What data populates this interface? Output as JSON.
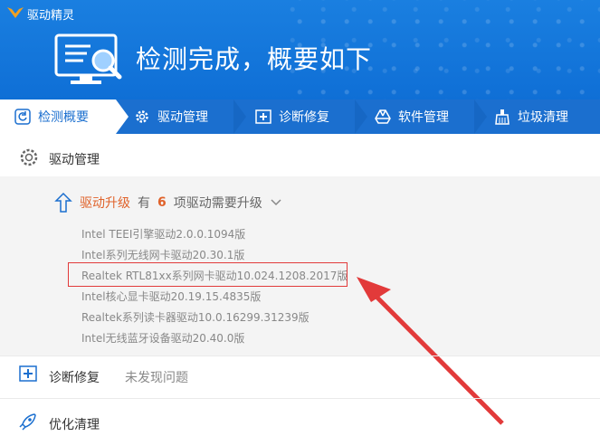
{
  "app": {
    "title": "驱动精灵"
  },
  "header": {
    "headline": "检测完成，概要如下"
  },
  "tabs": [
    {
      "label": "检测概要",
      "icon": "refresh-icon",
      "active": true
    },
    {
      "label": "驱动管理",
      "icon": "gear-icon",
      "active": false
    },
    {
      "label": "诊断修复",
      "icon": "medkit-icon",
      "active": false
    },
    {
      "label": "软件管理",
      "icon": "drive-icon",
      "active": false
    },
    {
      "label": "垃圾清理",
      "icon": "broom-icon",
      "active": false
    }
  ],
  "driver_section": {
    "title": "驱动管理",
    "upgrade": {
      "label": "驱动升级",
      "prefix": "有",
      "count": "6",
      "suffix": "项驱动需要升级"
    },
    "items": [
      "Intel TEEI引擎驱动2.0.0.1094版",
      "Intel系列无线网卡驱动20.30.1版",
      "Realtek RTL81xx系列网卡驱动10.024.1208.2017版",
      "Intel核心显卡驱动20.19.15.4835版",
      "Realtek系列读卡器驱动10.0.16299.31239版",
      "Intel无线蓝牙设备驱动20.40.0版"
    ]
  },
  "diagnose": {
    "title": "诊断修复",
    "status": "未发现问题"
  },
  "optimize": {
    "title": "优化清理"
  },
  "colors": {
    "header_blue": "#1a7fe0",
    "tab_blue": "#1b6fcf",
    "accent_orange": "#e0622a",
    "highlight_red": "#e23a3a"
  }
}
